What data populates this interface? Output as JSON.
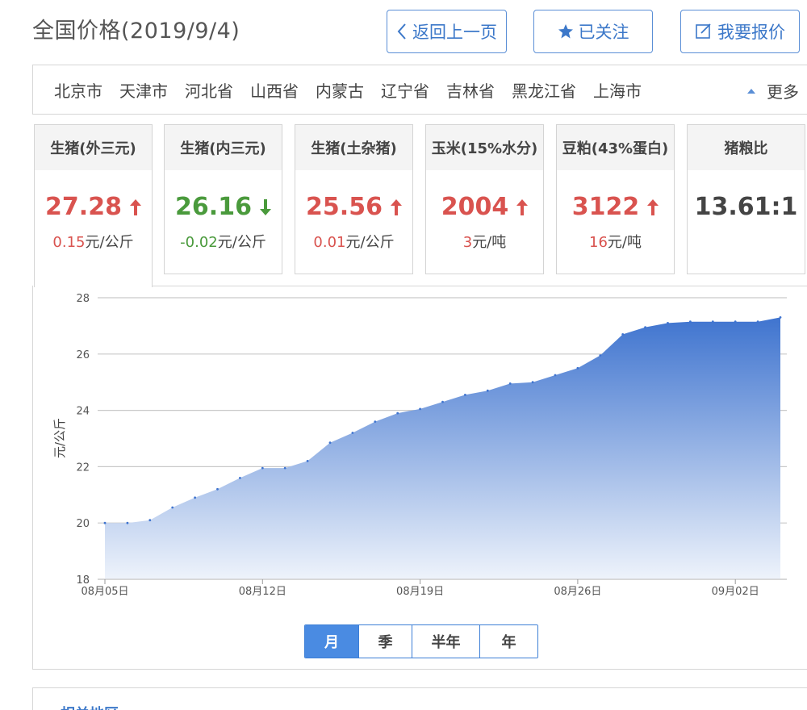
{
  "header": {
    "title": "全国价格(2019/9/4)",
    "back_label": "返回上一页",
    "follow_label": "已关注",
    "quote_label": "我要报价"
  },
  "regions": {
    "items": [
      "北京市",
      "天津市",
      "河北省",
      "山西省",
      "内蒙古",
      "辽宁省",
      "吉林省",
      "黑龙江省",
      "上海市"
    ],
    "more_label": "更多"
  },
  "cards": [
    {
      "name": "生猪(外三元)",
      "value": "27.28",
      "trend": "up",
      "change": "0.15",
      "unit": "元/公斤"
    },
    {
      "name": "生猪(内三元)",
      "value": "26.16",
      "trend": "down",
      "change": "-0.02",
      "unit": "元/公斤"
    },
    {
      "name": "生猪(土杂猪)",
      "value": "25.56",
      "trend": "up",
      "change": "0.01",
      "unit": "元/公斤"
    },
    {
      "name": "玉米(15%水分)",
      "value": "2004",
      "trend": "up",
      "change": "3",
      "unit": "元/吨"
    },
    {
      "name": "豆粕(43%蛋白)",
      "value": "3122",
      "trend": "up",
      "change": "16",
      "unit": "元/吨"
    },
    {
      "name": "猪粮比",
      "value": "13.61:1",
      "trend": "flat",
      "change": "",
      "unit": ""
    }
  ],
  "colors": {
    "up": "#d9534f",
    "down": "#4a9a3c",
    "accent": "#4a8be2",
    "area_top": "#3f74cf",
    "area_bottom": "#eef3fb"
  },
  "chart_data": {
    "type": "area",
    "ylabel": "元/公斤",
    "ylim": [
      18,
      28
    ],
    "yticks": [
      18,
      20,
      22,
      24,
      26,
      28
    ],
    "xtick_labels": [
      "08月05日",
      "08月12日",
      "08月19日",
      "08月26日",
      "09月02日"
    ],
    "grid": true,
    "x": [
      "08-05",
      "08-06",
      "08-07",
      "08-08",
      "08-09",
      "08-10",
      "08-11",
      "08-12",
      "08-13",
      "08-14",
      "08-15",
      "08-16",
      "08-17",
      "08-18",
      "08-19",
      "08-20",
      "08-21",
      "08-22",
      "08-23",
      "08-24",
      "08-25",
      "08-26",
      "08-27",
      "08-28",
      "08-29",
      "08-30",
      "08-31",
      "09-01",
      "09-02",
      "09-03",
      "09-04"
    ],
    "series": [
      {
        "values": [
          20.0,
          20.0,
          20.1,
          20.55,
          20.9,
          21.2,
          21.6,
          21.95,
          21.95,
          22.2,
          22.85,
          23.2,
          23.6,
          23.9,
          24.05,
          24.3,
          24.55,
          24.7,
          24.95,
          25.0,
          25.25,
          25.5,
          25.95,
          26.7,
          26.95,
          27.1,
          27.15,
          27.15,
          27.15,
          27.15,
          27.3
        ]
      }
    ]
  },
  "range_tabs": {
    "items": [
      "月",
      "季",
      "半年",
      "年"
    ],
    "active": "月"
  },
  "related": {
    "title": "相关地区"
  }
}
